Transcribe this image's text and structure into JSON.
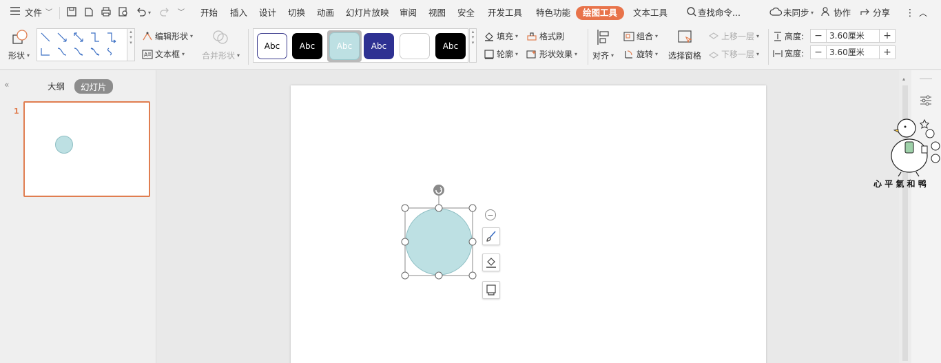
{
  "menubar": {
    "file": "文件",
    "tabs": [
      "开始",
      "插入",
      "设计",
      "切换",
      "动画",
      "幻灯片放映",
      "审阅",
      "视图",
      "安全",
      "开发工具",
      "特色功能",
      "绘图工具",
      "文本工具"
    ],
    "active_tab": "绘图工具",
    "search": "查找命令...",
    "sync": "未同步",
    "collab": "协作",
    "share": "分享"
  },
  "ribbon": {
    "shape": "形状",
    "edit_shape": "编辑形状",
    "text_box": "文本框",
    "merge_shape": "合并形状",
    "style_label": "Abc",
    "fill": "填充",
    "format_painter": "格式刷",
    "outline": "轮廓",
    "shape_effect": "形状效果",
    "align": "对齐",
    "group": "组合",
    "rotate": "旋转",
    "selection_pane": "选择窗格",
    "bring_forward": "上移一层",
    "send_backward": "下移一层",
    "height_label": "高度:",
    "height_value": "3.60厘米",
    "width_label": "宽度:",
    "width_value": "3.60厘米"
  },
  "leftpanel": {
    "outline_tab": "大纲",
    "slides_tab": "幻灯片",
    "slide_number": "1"
  },
  "sticker_text": "心 平 氣 和 鸭",
  "colors": {
    "accent": "#e8734a",
    "circle_fill": "#bde0e3",
    "circle_stroke": "#8fbfc4"
  }
}
